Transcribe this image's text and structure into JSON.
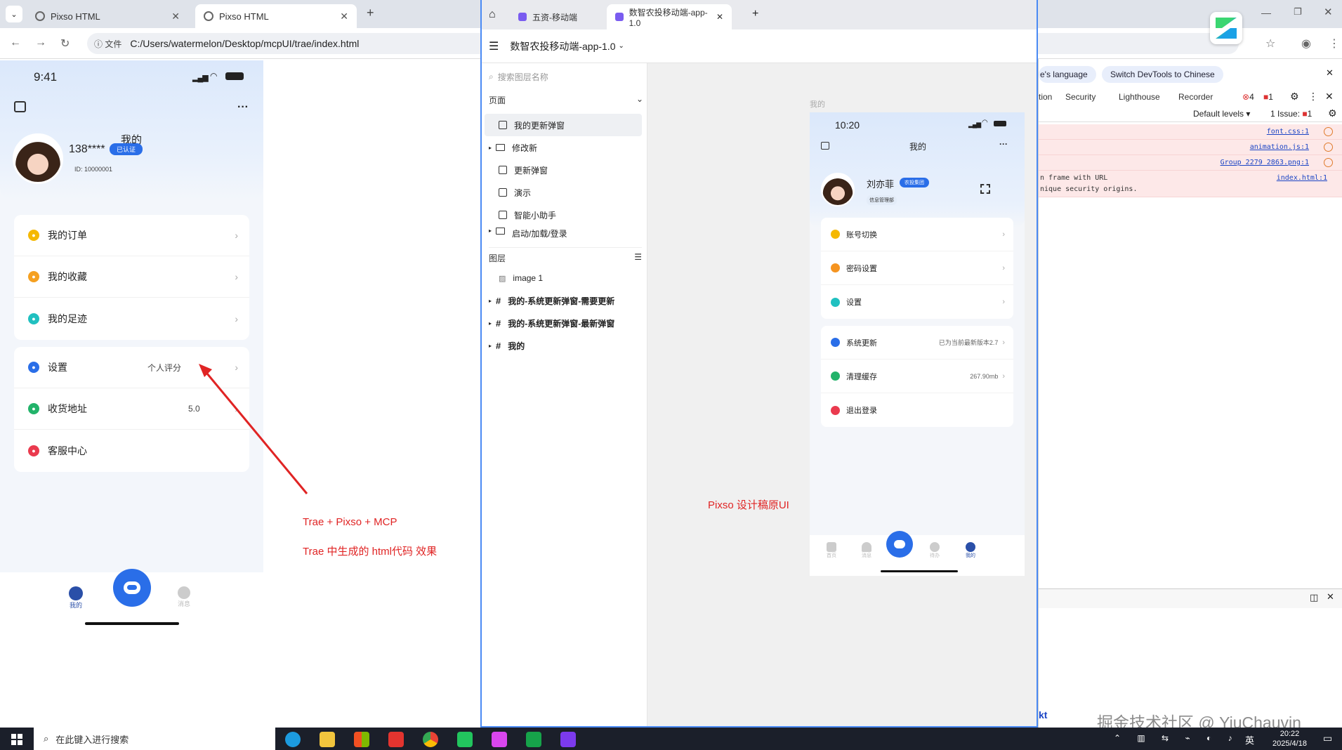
{
  "browser": {
    "tabs": [
      {
        "label": "Pixso HTML"
      },
      {
        "label": "Pixso HTML"
      }
    ],
    "file_label": "文件",
    "url": "C:/Users/watermelon/Desktop/mcpUI/trae/index.html"
  },
  "left_app": {
    "time": "9:41",
    "page_title": "我的",
    "phone": "138****",
    "verified": "已认证",
    "id_text": "ID: 10000001",
    "menu_group1": [
      {
        "label": "我的订单",
        "color": "#f5b800"
      },
      {
        "label": "我的收藏",
        "color": "#f5a020"
      },
      {
        "label": "我的足迹",
        "color": "#20c0c0"
      }
    ],
    "menu_group2": [
      {
        "label": "设置",
        "value": "个人评分",
        "color": "#2a6ee8"
      },
      {
        "label": "收货地址",
        "value": "5.0",
        "color": "#22b36a"
      },
      {
        "label": "客服中心",
        "value": "",
        "color": "#ea3a4e"
      }
    ],
    "bottom_nav": {
      "tab_mine": "我的",
      "tab_other": "消息"
    }
  },
  "annotations": {
    "left_line1": "Trae +  Pixso + MCP",
    "left_line2": "Trae 中生成的 html代码 效果",
    "right_line1": "Pixso 设计稿原UI"
  },
  "pixso": {
    "tabs": [
      {
        "label": "五资-移动端"
      },
      {
        "label": "数智农投移动端-app-1.0"
      }
    ],
    "file_title": "数智农投移动端-app-1.0",
    "search_placeholder": "搜索图层名称",
    "pages_title": "页面",
    "pages": [
      {
        "label": "我的更新弹窗",
        "type": "page",
        "selected": true
      },
      {
        "label": "修改新",
        "type": "folder"
      },
      {
        "label": "更新弹窗",
        "type": "page"
      },
      {
        "label": "演示",
        "type": "page"
      },
      {
        "label": "智能小助手",
        "type": "page"
      },
      {
        "label": "启动/加载/登录",
        "type": "folder"
      }
    ],
    "layers_title": "图层",
    "layers": [
      {
        "label": "image 1",
        "type": "image"
      },
      {
        "label": "我的-系统更新弹窗-需要更新",
        "type": "frame"
      },
      {
        "label": "我的-系统更新弹窗-最新弹窗",
        "type": "frame"
      },
      {
        "label": "我的",
        "type": "frame"
      }
    ],
    "frame_label": "我的",
    "design": {
      "time": "10:20",
      "title": "我的",
      "name": "刘亦菲",
      "badge": "农投集团",
      "dept": "信息管理部",
      "group1": [
        {
          "label": "账号切换",
          "color": "#f5b800"
        },
        {
          "label": "密码设置",
          "color": "#f59420"
        },
        {
          "label": "设置",
          "color": "#20c0c0"
        }
      ],
      "group2": [
        {
          "label": "系统更新",
          "value": "已为当前最新版本2.7",
          "color": "#2a6ee8"
        },
        {
          "label": "清理缓存",
          "value": "267.90mb",
          "color": "#22b36a"
        },
        {
          "label": "退出登录",
          "value": "",
          "color": "#ea3a4e"
        }
      ],
      "nav": [
        "首页",
        "消息",
        "",
        "待办",
        "我的"
      ]
    }
  },
  "devtools": {
    "lang_btn": "e's language",
    "switch_btn": "Switch DevTools to Chinese",
    "tabs": [
      "tion",
      "Security",
      "Lighthouse",
      "Recorder"
    ],
    "errors": "4",
    "warnings": "1",
    "levels": "Default levels",
    "issues": "1 Issue:",
    "issues_count": "1",
    "log": [
      {
        "text": "",
        "link": "font.css:1"
      },
      {
        "text": "",
        "link": "animation.js:1"
      },
      {
        "text": "",
        "link": "Group 2279 2863.png:1"
      },
      {
        "text": "n frame with URL",
        "link": "index.html:1"
      },
      {
        "text": "nique security origins.",
        "link": ""
      }
    ],
    "bottom_partial": "kt"
  },
  "watermark": "掘金技术社区 @ YiuChauvin",
  "taskbar": {
    "search": "在此键入进行搜索",
    "time": "20:22",
    "date": "2025/4/18",
    "ime": "英"
  }
}
